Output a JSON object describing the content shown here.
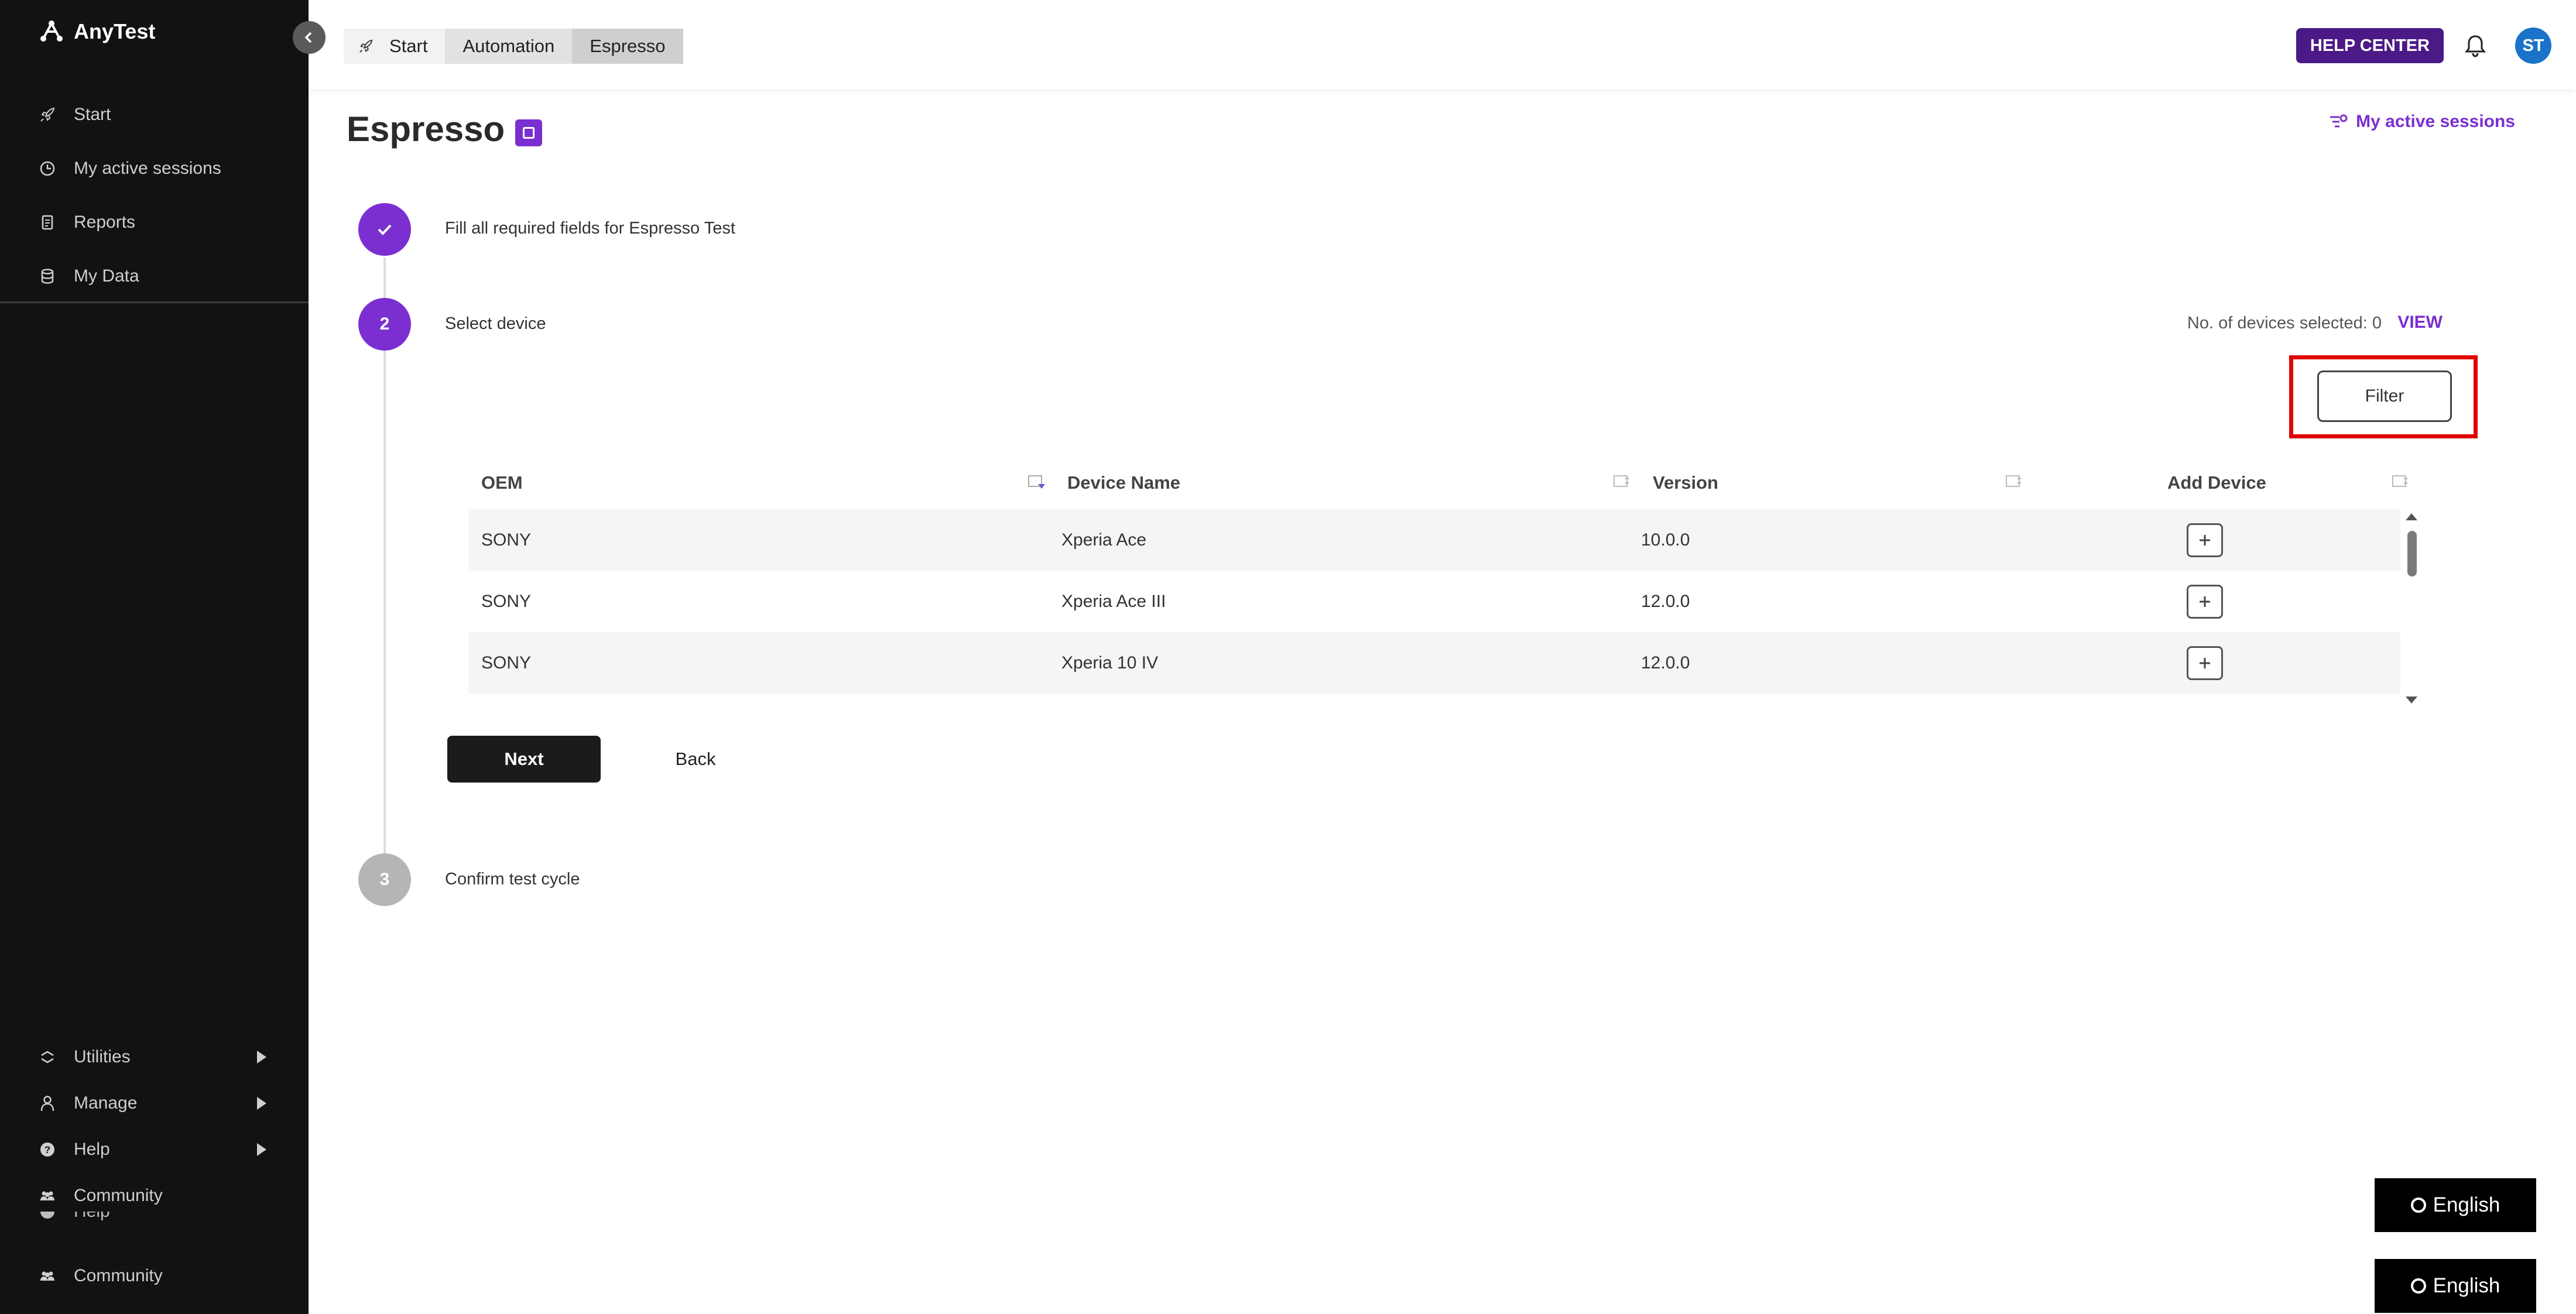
{
  "app": {
    "name": "AnyTest"
  },
  "sidebar": {
    "top_items": [
      {
        "label": "Start",
        "icon": "rocket-icon"
      },
      {
        "label": "My active sessions",
        "icon": "clock-icon"
      },
      {
        "label": "Reports",
        "icon": "report-icon"
      },
      {
        "label": "My Data",
        "icon": "database-icon"
      }
    ],
    "bottom_items": [
      {
        "label": "Utilities",
        "icon": "utilities-icon",
        "has_submenu": true
      },
      {
        "label": "Manage",
        "icon": "person-icon",
        "has_submenu": true
      },
      {
        "label": "Help",
        "icon": "help-icon",
        "has_submenu": true
      },
      {
        "label": "Community",
        "icon": "community-icon"
      }
    ],
    "ghost_item": {
      "label": "Help"
    },
    "community_duplicate": {
      "label": "Community"
    }
  },
  "breadcrumb": [
    "Start",
    "Automation",
    "Espresso"
  ],
  "header": {
    "help_center": "HELP CENTER",
    "avatar_initials": "ST"
  },
  "page": {
    "title": "Espresso",
    "active_sessions_link": "My active sessions"
  },
  "steps": [
    {
      "number": "1",
      "label": "Fill all required fields for Espresso Test",
      "status": "done"
    },
    {
      "number": "2",
      "label": "Select device",
      "status": "current"
    },
    {
      "number": "3",
      "label": "Confirm test cycle",
      "status": "pending"
    }
  ],
  "device_selection": {
    "selected_text": "No. of devices selected: 0",
    "view_label": "VIEW",
    "filter_label": "Filter"
  },
  "table": {
    "columns": [
      "OEM",
      "Device Name",
      "Version",
      "Add Device"
    ],
    "rows": [
      {
        "oem": "SONY",
        "device": "Xperia Ace",
        "version": "10.0.0"
      },
      {
        "oem": "SONY",
        "device": "Xperia Ace III",
        "version": "12.0.0"
      },
      {
        "oem": "SONY",
        "device": "Xperia 10 IV",
        "version": "12.0.0"
      }
    ]
  },
  "actions": {
    "next": "Next",
    "back": "Back"
  },
  "language": {
    "label": "English"
  },
  "colors": {
    "accent": "#7b2fd0",
    "help_center_bg": "#4b1a86",
    "sidebar_bg": "#121212",
    "highlight": "#e00000"
  }
}
